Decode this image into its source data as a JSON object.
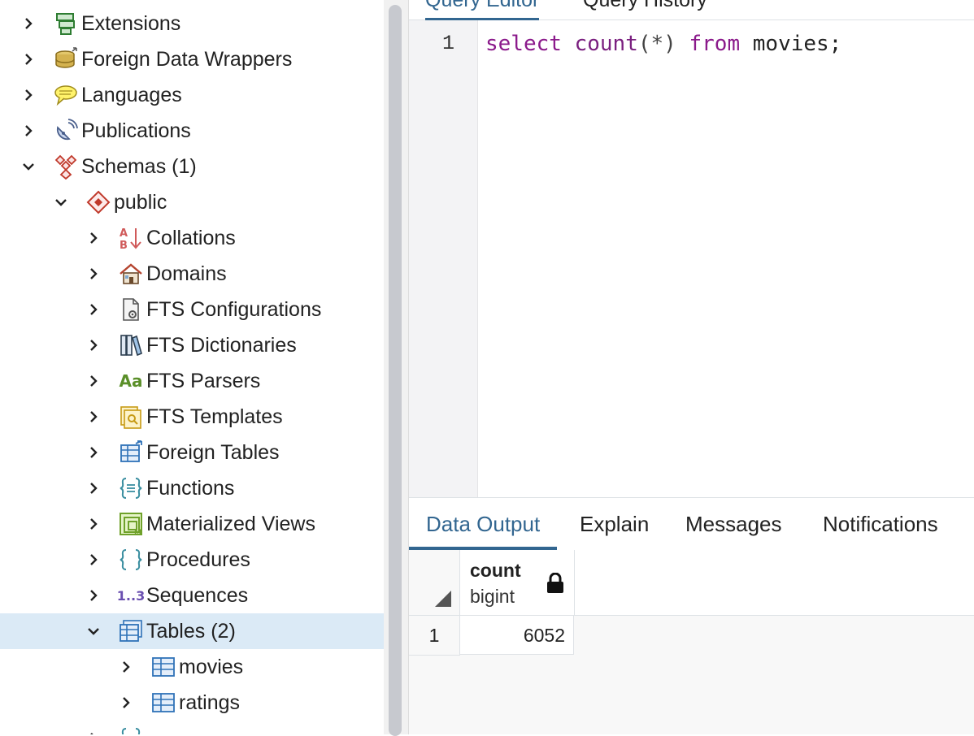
{
  "tree": {
    "items": [
      {
        "label": "Extensions",
        "icon": "extensions-icon",
        "state": "collapsed"
      },
      {
        "label": "Foreign Data Wrappers",
        "icon": "foreign-data-wrappers-icon",
        "state": "collapsed"
      },
      {
        "label": "Languages",
        "icon": "languages-icon",
        "state": "collapsed"
      },
      {
        "label": "Publications",
        "icon": "publications-icon",
        "state": "collapsed"
      },
      {
        "label": "Schemas (1)",
        "icon": "schemas-icon",
        "state": "expanded"
      },
      {
        "label": "public",
        "icon": "schema-public-icon",
        "state": "expanded"
      },
      {
        "label": "Collations",
        "icon": "collations-icon",
        "state": "collapsed"
      },
      {
        "label": "Domains",
        "icon": "domains-icon",
        "state": "collapsed"
      },
      {
        "label": "FTS Configurations",
        "icon": "fts-configurations-icon",
        "state": "collapsed"
      },
      {
        "label": "FTS Dictionaries",
        "icon": "fts-dictionaries-icon",
        "state": "collapsed"
      },
      {
        "label": "FTS Parsers",
        "icon": "fts-parsers-icon",
        "state": "collapsed",
        "icon_text": "Aa"
      },
      {
        "label": "FTS Templates",
        "icon": "fts-templates-icon",
        "state": "collapsed"
      },
      {
        "label": "Foreign Tables",
        "icon": "foreign-tables-icon",
        "state": "collapsed"
      },
      {
        "label": "Functions",
        "icon": "functions-icon",
        "state": "collapsed"
      },
      {
        "label": "Materialized Views",
        "icon": "materialized-views-icon",
        "state": "collapsed"
      },
      {
        "label": "Procedures",
        "icon": "procedures-icon",
        "state": "collapsed"
      },
      {
        "label": "Sequences",
        "icon": "sequences-icon",
        "state": "collapsed",
        "icon_text": "1..3"
      },
      {
        "label": "Tables (2)",
        "icon": "tables-icon",
        "state": "expanded",
        "selected": true
      },
      {
        "label": "movies",
        "icon": "table-icon",
        "state": "collapsed"
      },
      {
        "label": "ratings",
        "icon": "table-icon",
        "state": "collapsed"
      }
    ]
  },
  "editor": {
    "tabs": [
      "Query Editor",
      "Query History"
    ],
    "active_tab": "Query Editor",
    "line_number": "1",
    "code": {
      "kw1": "select",
      "fn": "count",
      "paren": "(*)",
      "kw2": "from",
      "rest": "movies;"
    }
  },
  "output": {
    "tabs": [
      "Data Output",
      "Explain",
      "Messages",
      "Notifications"
    ],
    "active_tab": "Data Output",
    "column": {
      "name": "count",
      "type": "bigint"
    },
    "rows": [
      {
        "num": "1",
        "value": "6052"
      }
    ]
  },
  "colors": {
    "accent": "#326690",
    "keyword": "#8b1a8b",
    "selected_bg": "#dbeaf6"
  }
}
